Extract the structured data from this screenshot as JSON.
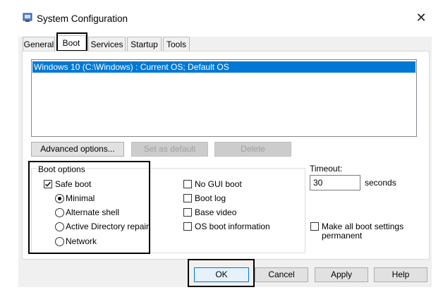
{
  "window": {
    "title": "System Configuration",
    "close_glyph": "✕",
    "icon": "system-config-icon"
  },
  "tabs": [
    {
      "label": "General",
      "active": false
    },
    {
      "label": "Boot",
      "active": true
    },
    {
      "label": "Services",
      "active": false
    },
    {
      "label": "Startup",
      "active": false
    },
    {
      "label": "Tools",
      "active": false
    }
  ],
  "os_list": {
    "items": [
      "Windows 10 (C:\\Windows) : Current OS; Default OS"
    ],
    "selected_index": 0
  },
  "list_buttons": {
    "advanced": "Advanced options...",
    "set_default": "Set as default",
    "delete": "Delete"
  },
  "boot_options": {
    "group_label": "Boot options",
    "safe_boot": {
      "label": "Safe boot",
      "checked": true
    },
    "radios": [
      {
        "label": "Minimal",
        "selected": true
      },
      {
        "label": "Alternate shell",
        "selected": false
      },
      {
        "label": "Active Directory repair",
        "selected": false
      },
      {
        "label": "Network",
        "selected": false
      }
    ],
    "checkboxes": [
      {
        "label": "No GUI boot",
        "checked": false
      },
      {
        "label": "Boot log",
        "checked": false
      },
      {
        "label": "Base video",
        "checked": false
      },
      {
        "label": "OS boot information",
        "checked": false
      }
    ]
  },
  "timeout": {
    "label": "Timeout:",
    "value": "30",
    "unit": "seconds"
  },
  "permanent": {
    "line1": "Make all boot settings",
    "line2": "permanent",
    "checked": false
  },
  "dialog_buttons": {
    "ok": "OK",
    "cancel": "Cancel",
    "apply": "Apply",
    "help": "Help"
  },
  "colors": {
    "selection": "#0078d7",
    "dialog_bg": "#f0f0f0"
  }
}
